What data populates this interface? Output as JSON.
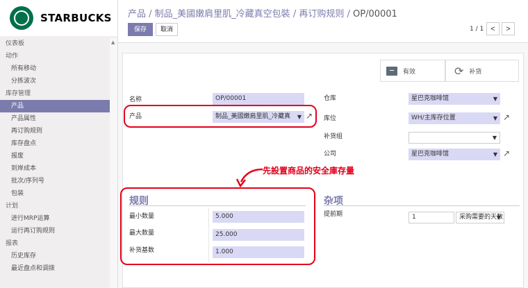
{
  "brand": {
    "name": "STARBUCKS",
    "color": "#00704a"
  },
  "sidebar": {
    "items": [
      {
        "label": "仪表板",
        "type": "section"
      },
      {
        "label": "动作",
        "type": "section"
      },
      {
        "label": "所有移动",
        "type": "item"
      },
      {
        "label": "分拣波次",
        "type": "item"
      },
      {
        "label": "库存管理",
        "type": "section"
      },
      {
        "label": "产品",
        "type": "item",
        "active": true
      },
      {
        "label": "产品属性",
        "type": "item"
      },
      {
        "label": "再订购规则",
        "type": "item"
      },
      {
        "label": "库存盘点",
        "type": "item"
      },
      {
        "label": "报废",
        "type": "item"
      },
      {
        "label": "到岸成本",
        "type": "item"
      },
      {
        "label": "批次/序列号",
        "type": "item"
      },
      {
        "label": "包装",
        "type": "item"
      },
      {
        "label": "计划",
        "type": "section"
      },
      {
        "label": "进行MRP运算",
        "type": "item"
      },
      {
        "label": "运行再订购规则",
        "type": "item"
      },
      {
        "label": "报表",
        "type": "section"
      },
      {
        "label": "历史库存",
        "type": "item"
      },
      {
        "label": "最近盘点和调拨",
        "type": "item"
      }
    ]
  },
  "breadcrumb": {
    "crumb1": "产品",
    "crumb2": "制品_美國嫩肩里肌_冷藏真空包裝",
    "crumb3": "再订购规则",
    "current": "OP/00001",
    "separator": " / "
  },
  "toolbar": {
    "save_label": "保存",
    "discard_label": "取消"
  },
  "pager": {
    "value": "1 / 1",
    "prev": "<",
    "next": ">"
  },
  "smart_buttons": {
    "active_label": "有效",
    "replenish_label": "补货"
  },
  "form": {
    "name_label": "名称",
    "name_value": "OP/00001",
    "product_label": "产品",
    "product_value": "制品_美國嫩肩里肌_冷藏真",
    "warehouse_label": "仓库",
    "warehouse_value": "星巴克咖啡馆",
    "location_label": "库位",
    "location_value": "WH/主库存位置",
    "group_label": "补货组",
    "group_value": "",
    "company_label": "公司",
    "company_value": "星巴克咖啡馆"
  },
  "rules": {
    "title": "规则",
    "min_label": "最小数量",
    "min_value": "5.000",
    "max_label": "最大数量",
    "max_value": "25.000",
    "multiple_label": "补货基数",
    "multiple_value": "1.000"
  },
  "misc": {
    "title": "杂项",
    "lead_label": "提前期",
    "lead_value": "1",
    "lead_unit": "采购需要的天数"
  },
  "annotation": {
    "text": "先設置商品的安全庫存量",
    "color": "#e2001a"
  },
  "colors": {
    "accent": "#7c7bad",
    "field_bg": "#d9d9f5"
  }
}
